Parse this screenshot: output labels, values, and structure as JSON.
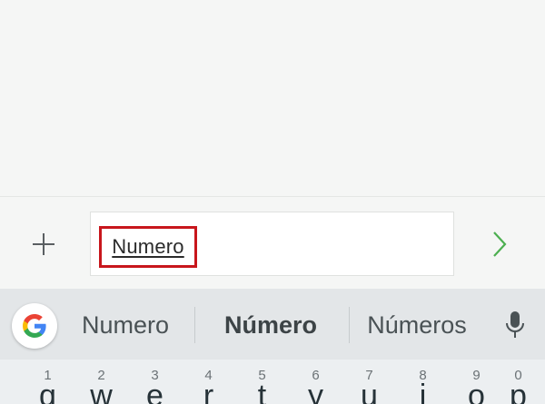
{
  "composer": {
    "typed_text": "Numero",
    "plus_icon": "plus-icon",
    "send_icon": "chevron-right-icon"
  },
  "keyboard": {
    "suggestions": [
      "Numero",
      "Número",
      "Números"
    ],
    "google_icon": "google-g-icon",
    "mic_icon": "microphone-icon",
    "top_row": [
      {
        "letter": "q",
        "hint": "1"
      },
      {
        "letter": "w",
        "hint": "2"
      },
      {
        "letter": "e",
        "hint": "3"
      },
      {
        "letter": "r",
        "hint": "4"
      },
      {
        "letter": "t",
        "hint": "5"
      },
      {
        "letter": "y",
        "hint": "6"
      },
      {
        "letter": "u",
        "hint": "7"
      },
      {
        "letter": "i",
        "hint": "8"
      },
      {
        "letter": "o",
        "hint": "9"
      },
      {
        "letter": "p",
        "hint": "0"
      }
    ]
  },
  "colors": {
    "background": "#f5f6f5",
    "highlight_box": "#c8161c",
    "send_accent": "#4caf50",
    "suggestion_bar": "#e3e6e8",
    "keyboard": "#eceff1"
  }
}
